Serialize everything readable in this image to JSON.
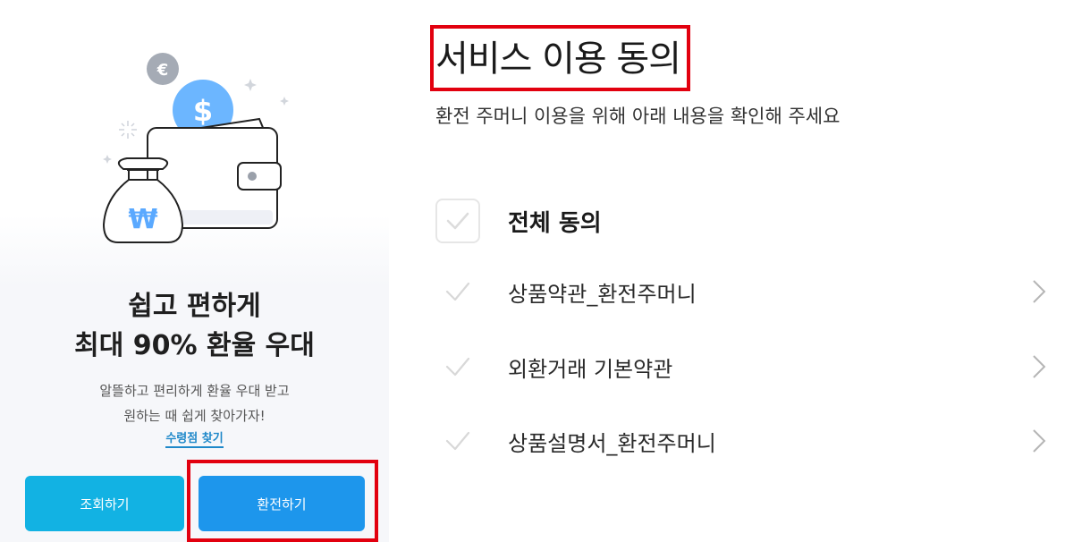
{
  "promo": {
    "headline_line1": "쉽고 편하게",
    "headline_line2": "최대 90% 환율 우대",
    "desc_line1": "알뜰하고 편리하게 환율 우대 받고",
    "desc_line2": "원하는 때 쉽게 찾아가자!",
    "store_link": "수령점 찾기",
    "inquiry_button": "조회하기",
    "exchange_button": "환전하기",
    "illustration": {
      "euro_coin_symbol": "€",
      "dollar_coin_symbol": "$",
      "won_bag_symbol": "₩"
    }
  },
  "agreement": {
    "title": "서비스 이용 동의",
    "subtitle": "환전 주머니 이용을 위해 아래 내용을 확인해 주세요",
    "all_agree_label": "전체 동의",
    "terms": [
      {
        "label": "상품약관_환전주머니"
      },
      {
        "label": "외환거래 기본약관"
      },
      {
        "label": "상품설명서_환전주머니"
      }
    ]
  },
  "colors": {
    "inquiry_button": "#12b2e3",
    "exchange_button": "#1d96ec",
    "link": "#1e88c9",
    "highlight": "#e2000f",
    "check_inactive": "#d8d8d8"
  }
}
